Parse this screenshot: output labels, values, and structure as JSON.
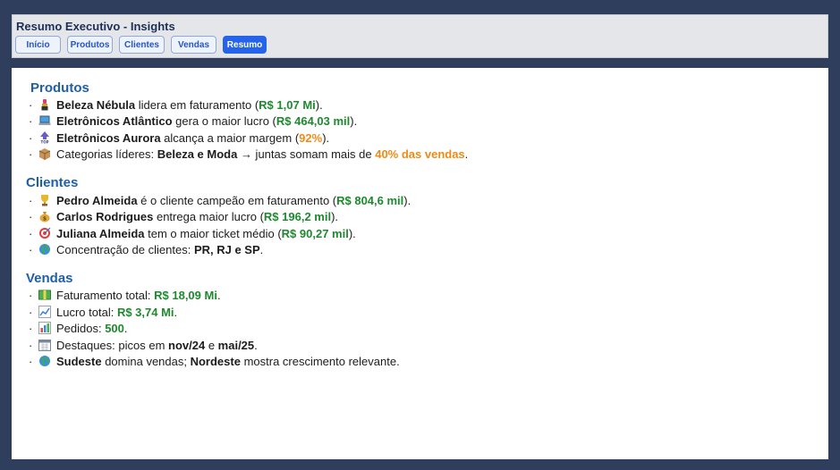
{
  "header": {
    "title": "Resumo Executivo - Insights",
    "tabs": [
      {
        "label": "Início"
      },
      {
        "label": "Produtos"
      },
      {
        "label": "Clientes"
      },
      {
        "label": "Vendas"
      },
      {
        "label": "Resumo",
        "active": true
      }
    ]
  },
  "colors": {
    "background": "#2f3e5c",
    "accent": "#2563eb",
    "section_title": "#1f5fa8",
    "money_green": "#1d8a2e",
    "highlight_orange": "#ef8a17"
  },
  "produtos": {
    "title": "Produtos",
    "items": [
      {
        "icon": "lipstick-icon",
        "parts": [
          "Beleza Nébula",
          " lidera em faturamento (",
          "R$ 1,07 Mi",
          ")."
        ]
      },
      {
        "icon": "laptop-icon",
        "parts": [
          "Eletrônicos Atlântico",
          " gera o maior lucro (",
          "R$ 464,03 mil",
          ")."
        ]
      },
      {
        "icon": "top-arrow-icon",
        "parts": [
          "Eletrônicos Aurora",
          " alcança a maior margem (",
          "92%",
          ")."
        ]
      },
      {
        "icon": "package-icon",
        "parts": [
          "Categorias líderes: ",
          "Beleza e Moda",
          " → juntas somam mais de ",
          "40% das vendas",
          "."
        ]
      }
    ]
  },
  "clientes": {
    "title": "Clientes",
    "items": [
      {
        "icon": "trophy-icon",
        "parts": [
          "Pedro Almeida",
          " é o cliente campeão em faturamento (",
          "R$ 804,6 mil",
          ")."
        ]
      },
      {
        "icon": "money-bag-icon",
        "parts": [
          "Carlos Rodrigues",
          " entrega maior lucro (",
          "R$ 196,2 mil",
          ")."
        ]
      },
      {
        "icon": "target-icon",
        "parts": [
          "Juliana Almeida",
          " tem o maior ticket médio (",
          "R$ 90,27 mil",
          ")."
        ]
      },
      {
        "icon": "globe-icon",
        "parts": [
          "Concentração de clientes: ",
          "PR, RJ e SP",
          "."
        ]
      }
    ]
  },
  "vendas": {
    "title": "Vendas",
    "items": [
      {
        "icon": "banknote-icon",
        "parts": [
          "Faturamento total: ",
          "R$ 18,09 Mi",
          "."
        ]
      },
      {
        "icon": "chart-up-icon",
        "parts": [
          "Lucro total: ",
          "R$ 3,74 Mi",
          "."
        ]
      },
      {
        "icon": "bar-chart-icon",
        "parts": [
          "Pedidos: ",
          "500",
          "."
        ]
      },
      {
        "icon": "calendar-icon",
        "parts": [
          "Destaques: picos em ",
          "nov/24",
          " e ",
          "mai/25",
          "."
        ]
      },
      {
        "icon": "globe-icon",
        "parts": [
          "Sudeste",
          " domina vendas; ",
          "Nordeste",
          " mostra crescimento relevante."
        ]
      }
    ]
  }
}
